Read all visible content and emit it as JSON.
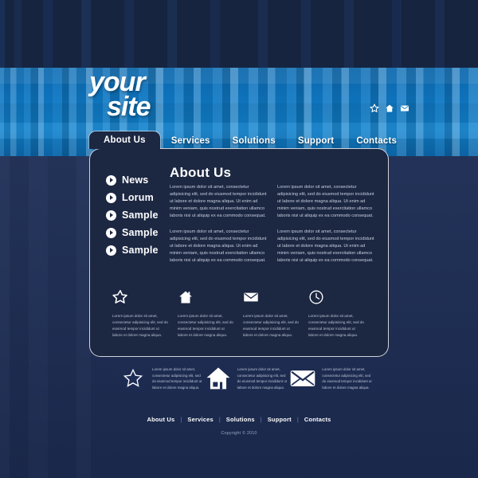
{
  "site": {
    "logo_line1": "your",
    "logo_line2": "site"
  },
  "header_icons": [
    {
      "name": "star-icon",
      "glyph": "star"
    },
    {
      "name": "home-icon",
      "glyph": "home"
    },
    {
      "name": "envelope-icon",
      "glyph": "envelope"
    }
  ],
  "nav": {
    "tabs": [
      {
        "label": "About Us",
        "active": true
      },
      {
        "label": "Services",
        "active": false
      },
      {
        "label": "Solutions",
        "active": false
      },
      {
        "label": "Support",
        "active": false
      },
      {
        "label": "Contacts",
        "active": false
      }
    ]
  },
  "sidebar": {
    "items": [
      {
        "label": "News"
      },
      {
        "label": "Lorum"
      },
      {
        "label": "Sample"
      },
      {
        "label": "Sample"
      },
      {
        "label": "Sample"
      }
    ]
  },
  "main": {
    "heading": "About Us",
    "columns": [
      {
        "paragraphs": [
          "Lorem ipsum dolor sit amet, consectetur adipisicing elit, sed do eiusmod tempor incididunt ut labore et dolore magna aliqua. Ut enim ad minim veniam, quis nostrud exercitation ullamco laboris nisi ut aliquip ex ea commodo consequat.",
          "Lorem ipsum dolor sit amet, consectetur adipisicing elit, sed do eiusmod tempor incididunt ut labore et dolore magna aliqua. Ut enim ad minim veniam, quis nostrud exercitation ullamco laboris nisi ut aliquip ex ea commodo consequat."
        ]
      },
      {
        "paragraphs": [
          "Lorem ipsum dolor sit amet, consectetur adipisicing elit, sed do eiusmod tempor incididunt ut labore et dolore magna aliqua. Ut enim ad minim veniam, quis nostrud exercitation ullamco laboris nisi ut aliquip ex ea commodo consequat.",
          "Lorem ipsum dolor sit amet, consectetur adipisicing elit, sed do eiusmod tempor incididunt ut labore et dolore magna aliqua. Ut enim ad minim veniam, quis nostrud exercitation ullamco laboris nisi ut aliquip ex ea commodo consequat."
        ]
      }
    ]
  },
  "features": [
    {
      "icon": "star-icon",
      "text": "Lorem ipsum dolor sit amet, consectetur adipisicing elit, sed do eiusmod tempor incididunt ut labore et dolore magna aliqua."
    },
    {
      "icon": "home-icon",
      "text": "Lorem ipsum dolor sit amet, consectetur adipisicing elit, sed do eiusmod tempor incididunt ut labore et dolore magna aliqua."
    },
    {
      "icon": "envelope-icon",
      "text": "Lorem ipsum dolor sit amet, consectetur adipisicing elit, sed do eiusmod tempor incididunt ut labore et dolore magna aliqua."
    },
    {
      "icon": "clock-icon",
      "text": "Lorem ipsum dolor sit amet, consectetur adipisicing elit, sed do eiusmod tempor incididunt ut labore et dolore magna aliqua."
    }
  ],
  "bottom_features": [
    {
      "icon": "star-icon",
      "text": "Lorem ipsum dolor sit amet, consectetur adipisicing elit, sed do eiusmod tempor incididunt ut labore et dolore magna aliqua."
    },
    {
      "icon": "home-icon",
      "text": "Lorem ipsum dolor sit amet, consectetur adipisicing elit, sed do eiusmod tempor incididunt ut labore et dolore magna aliqua."
    },
    {
      "icon": "envelope-icon",
      "text": "Lorem ipsum dolor sit amet, consectetur adipisicing elit, sed do eiusmod tempor incididunt ut labore et dolore magna aliqua."
    }
  ],
  "footer": {
    "links": [
      "About Us",
      "Services",
      "Solutions",
      "Support",
      "Contacts"
    ],
    "separator": "|",
    "copyright": "Copyright © 2010"
  },
  "colors": {
    "banner_blue": "#0f78c4",
    "panel_navy": "#1c2742",
    "page_navy": "#1d2d55",
    "top_strip": "#16243f",
    "text_white": "#ffffff",
    "text_muted": "#c7cfdf"
  }
}
